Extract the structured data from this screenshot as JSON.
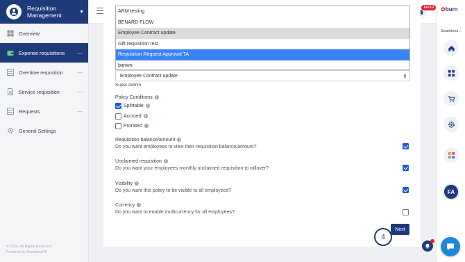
{
  "app": {
    "title": "Requisition Management",
    "footer_line1": "© 2024. All Rights Reserved.",
    "footer_line2": "Powered by SeamlessHR"
  },
  "sidebar": {
    "items": [
      {
        "label": "Overview",
        "icon": "grid-icon",
        "expandable": false
      },
      {
        "label": "Expense requisitions",
        "icon": "wallet-icon",
        "expandable": true,
        "active": true
      },
      {
        "label": "Overtime requisition",
        "icon": "list-icon",
        "expandable": true
      },
      {
        "label": "Service requisition",
        "icon": "document-icon",
        "expandable": true
      },
      {
        "label": "Requests",
        "icon": "list-icon",
        "expandable": true
      },
      {
        "label": "General Settings",
        "icon": "gear-icon",
        "expandable": false
      }
    ]
  },
  "topbar": {
    "notification_count": "14713"
  },
  "rail": {
    "logo_text": "burn",
    "caption": "Seamless...",
    "avatar_initials": "FA"
  },
  "dropdown": {
    "options": [
      "ARM testing",
      "BENARD FLOW",
      "Employee Contract update",
      "Gift requisition test",
      "Requisition Request Approval TA",
      "banwo"
    ],
    "hovered": "Employee Contract update",
    "selected": "Requisition Request Approval TA"
  },
  "form": {
    "select_value": "Employee Contract update",
    "approver": "Super Admin",
    "policy_conditions_label": "Policy Conditions",
    "conditions": [
      {
        "label": "Splittable",
        "checked": true
      },
      {
        "label": "Accrued",
        "checked": false
      },
      {
        "label": "Prorated",
        "checked": false
      }
    ],
    "settings": [
      {
        "title": "Requisition balance/amount",
        "description": "Do you want employees to view their requisition balance/amount?",
        "checked": true
      },
      {
        "title": "Unclaimed requisition",
        "description": "Do you want your employees monthly unclaimed requisition to rollover?",
        "checked": true
      },
      {
        "title": "Visibility",
        "description": "Do you want this policy to be visible to all employees?",
        "checked": true
      },
      {
        "title": "Currency",
        "description": "Do you want to enable multicurrency for all employees?",
        "checked": false
      }
    ],
    "next_label": "Next",
    "step_number": "4"
  }
}
